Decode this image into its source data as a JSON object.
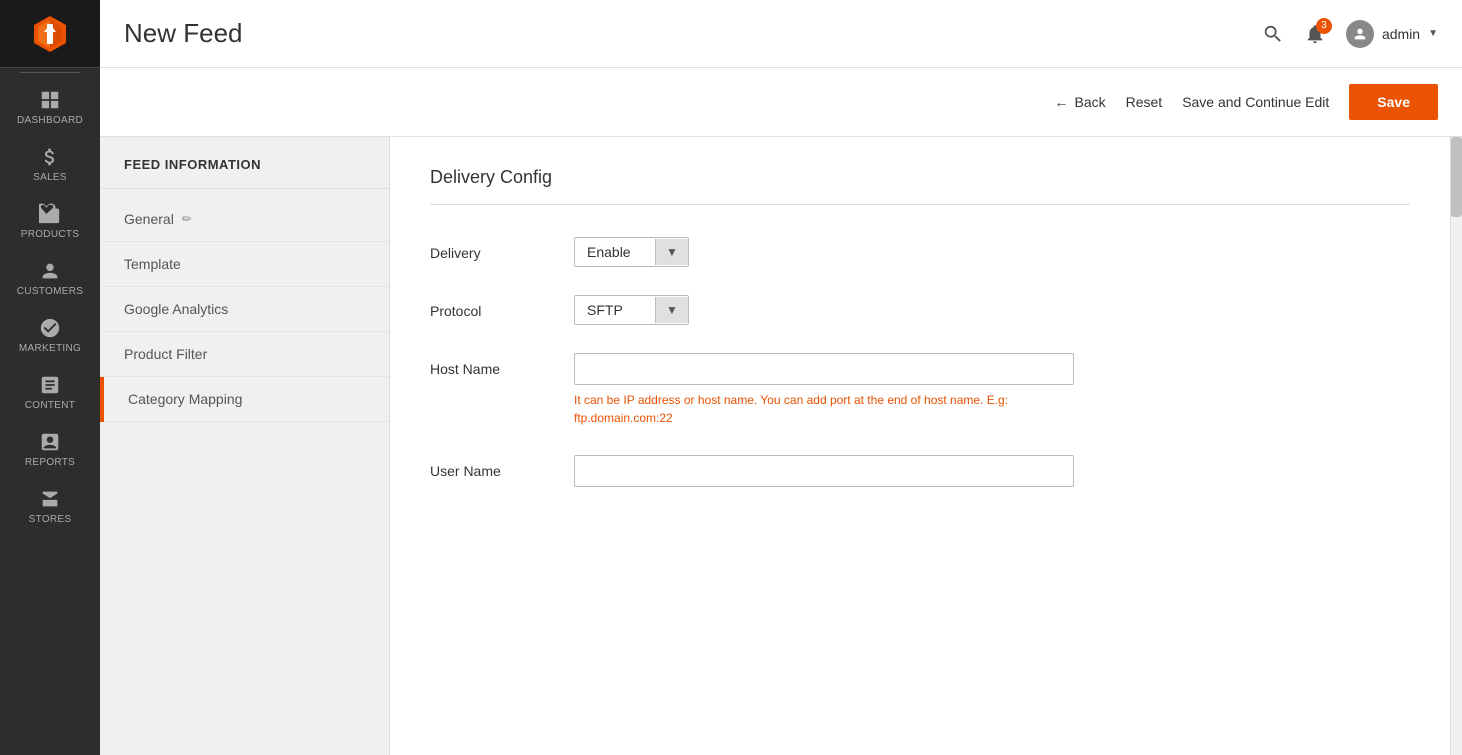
{
  "sidebar": {
    "items": [
      {
        "id": "dashboard",
        "label": "DASHBOARD",
        "icon": "dashboard"
      },
      {
        "id": "sales",
        "label": "SALES",
        "icon": "sales"
      },
      {
        "id": "products",
        "label": "PRODUCTS",
        "icon": "products"
      },
      {
        "id": "customers",
        "label": "CUSTOMERS",
        "icon": "customers"
      },
      {
        "id": "marketing",
        "label": "MARKETING",
        "icon": "marketing"
      },
      {
        "id": "content",
        "label": "CONTENT",
        "icon": "content"
      },
      {
        "id": "reports",
        "label": "REPORTS",
        "icon": "reports"
      },
      {
        "id": "stores",
        "label": "STORES",
        "icon": "stores"
      }
    ]
  },
  "header": {
    "page_title": "New Feed",
    "notification_count": "3",
    "user_label": "admin"
  },
  "action_bar": {
    "back_label": "Back",
    "reset_label": "Reset",
    "save_continue_label": "Save and Continue Edit",
    "save_label": "Save"
  },
  "left_panel": {
    "section_title": "FEED INFORMATION",
    "nav_items": [
      {
        "id": "general",
        "label": "General",
        "active": false,
        "edit": true
      },
      {
        "id": "template",
        "label": "Template",
        "active": false,
        "edit": false
      },
      {
        "id": "google-analytics",
        "label": "Google Analytics",
        "active": false,
        "edit": false
      },
      {
        "id": "product-filter",
        "label": "Product Filter",
        "active": false,
        "edit": false
      },
      {
        "id": "category-mapping",
        "label": "Category Mapping",
        "active": false,
        "edit": false
      }
    ]
  },
  "main": {
    "section_title": "Delivery Config",
    "fields": {
      "delivery": {
        "label": "Delivery",
        "value": "Enable"
      },
      "protocol": {
        "label": "Protocol",
        "value": "SFTP"
      },
      "host_name": {
        "label": "Host Name",
        "value": "",
        "placeholder": "",
        "help_text": "It can be IP address or host name. You can add port at the end of host name. E.g: ftp.domain.com:22"
      },
      "user_name": {
        "label": "User Name",
        "value": "",
        "placeholder": ""
      }
    }
  }
}
